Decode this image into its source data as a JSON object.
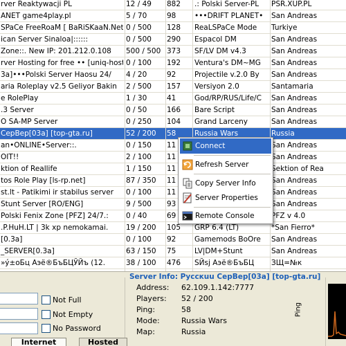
{
  "server_list": {
    "rows": [
      {
        "host": "rver Reaktywacji PL",
        "players": "12 / 49",
        "ping": "882",
        "mode": ".: Polski Server-PL",
        "map": "PSR.XUP.PL"
      },
      {
        "host": "ANET game4play.pl",
        "players": "5 / 70",
        "ping": "98",
        "mode": "•••DRIFT PLANET•",
        "map": "San Andreas"
      },
      {
        "host": "SPaCe FreeRoaM [ BaRiSKaaN.Net",
        "players": "0 / 500",
        "ping": "128",
        "mode": "ReaLSPaCe Mode",
        "map": "Turkiye"
      },
      {
        "host": "ican Server Sinaloa|::::::",
        "players": "0 / 500",
        "ping": "290",
        "mode": "Espacol DM",
        "map": "San Andreas"
      },
      {
        "host": "Zone::. New IP: 201.212.0.108",
        "players": "500 / 500",
        "ping": "373",
        "mode": "SF/LV DM v4.3",
        "map": "San Andreas"
      },
      {
        "host": "rver Hosting for free •• [uniq-host",
        "players": "0 / 100",
        "ping": "192",
        "mode": "Ventura's DM~MG",
        "map": "San Andreas"
      },
      {
        "host": "3a]•••Polski Server Haosu 24/",
        "players": "4 / 20",
        "ping": "92",
        "mode": "Projectile v.2.0 By",
        "map": "San Andreas"
      },
      {
        "host": "aria Roleplay v2.5 Geliyor Bakin",
        "players": "2 / 500",
        "ping": "157",
        "mode": "Versiyon 2.0",
        "map": "Santamaria"
      },
      {
        "host": "e RolePlay",
        "players": "1 / 30",
        "ping": "41",
        "mode": "God/RP/RUS/Life/C",
        "map": "San Andreas"
      },
      {
        "host": ".3 Server",
        "players": "0 / 50",
        "ping": "166",
        "mode": "Bare Script",
        "map": "San Andreas"
      },
      {
        "host": "O SA-MP Server",
        "players": "0 / 250",
        "ping": "104",
        "mode": "Grand Larceny",
        "map": "San Andreas"
      },
      {
        "host": "СерВер[03a] [top-gta.ru]",
        "players": "52 / 200",
        "ping": "58",
        "mode": "Russia Wars",
        "map": "Russia"
      },
      {
        "host": "an•ONLINE•Server::.",
        "players": "0 / 150",
        "ping": "11",
        "mode": "",
        "map": "San Andreas"
      },
      {
        "host": "OIT!!",
        "players": "2 / 100",
        "ping": "11",
        "mode": "",
        "map": "San Andreas"
      },
      {
        "host": "ktion of Reallife",
        "players": "1 / 150",
        "ping": "11",
        "mode": "",
        "map": "Sektion of Rea"
      },
      {
        "host": "tos Role Play [ls-rp.net]",
        "players": "87 / 350",
        "ping": "11",
        "mode": "",
        "map": "San Andreas"
      },
      {
        "host": "st.lt - Patikimi ir stabilus server",
        "players": "0 / 100",
        "ping": "11",
        "mode": "",
        "map": "San Andreas"
      },
      {
        "host": "Stunt Server [RO/ENG]",
        "players": "9 / 500",
        "ping": "93",
        "mode": "",
        "map": "San Andreas"
      },
      {
        "host": "Polski Fenix Zone [PFZ] 24/7.:",
        "players": "0 / 40",
        "ping": "69",
        "mode": "",
        "map": "PFZ v 4.0"
      },
      {
        "host": ".P.HuH.LT | 3k xp nemokamai.",
        "players": "19 / 200",
        "ping": "105",
        "mode": "GRP 6.4 (LT)",
        "map": "*San Fierro*"
      },
      {
        "host": "[0.3a]",
        "players": "0 / 100",
        "ping": "92",
        "mode": "Gamemods BoOre",
        "map": "San Andreas"
      },
      {
        "host": "_SERVER[0.3a]",
        "players": "63 / 150",
        "ping": "75",
        "mode": "LV|DM+Stunt",
        "map": "San Andreas"
      },
      {
        "host": "»ý±оБц Аэё®БъБЦЎЙъ (12.",
        "players": "38 / 100",
        "ping": "476",
        "mode": "SЙsj Аэё®БъБЦ",
        "map": "ЗЩ=№к"
      }
    ],
    "selected_index": 11
  },
  "context_menu": {
    "items": [
      {
        "label": "Connect",
        "icon": "connect-icon"
      },
      {
        "label": "Refresh Server",
        "icon": "refresh-icon"
      },
      {
        "label": "Copy Server Info",
        "icon": "copy-icon"
      },
      {
        "label": "Server Properties",
        "icon": "properties-icon"
      },
      {
        "label": "Remote Console",
        "icon": "console-icon"
      }
    ]
  },
  "filters": {
    "not_full": "Not Full",
    "not_empty": "Not Empty",
    "no_password": "No Password"
  },
  "server_info": {
    "title": "Server Info: Русскuu СерВер[03a] [top-gta.ru]",
    "labels": {
      "address": "Address:",
      "players": "Players:",
      "ping": "Ping:",
      "mode": "Mode:",
      "map": "Map:"
    },
    "values": {
      "address": "62.109.1.142:7777",
      "players": "52 / 200",
      "ping": "58",
      "mode": "Russia Wars",
      "map": "Russia"
    }
  },
  "ping_graph": {
    "label": "Ping"
  },
  "tabs": [
    {
      "label": "Internet",
      "active": true
    },
    {
      "label": "Hosted",
      "active": false
    }
  ],
  "colors": {
    "selection": "#316ac5",
    "info_title": "#1d5fb8",
    "graph_bg": "#000000",
    "graph_line": "#d2691e"
  }
}
